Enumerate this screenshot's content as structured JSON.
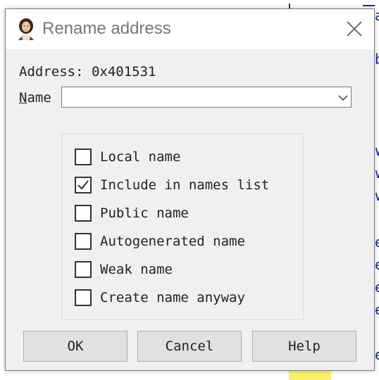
{
  "dialog": {
    "title": "Rename address",
    "address_text": "Address: 0x401531",
    "name_label_mnemonic": "N",
    "name_label_rest": "ame",
    "name_value": ""
  },
  "options": [
    {
      "label": "Local name",
      "checked": false
    },
    {
      "label": "Include in names list",
      "checked": true
    },
    {
      "label": "Public name",
      "checked": false
    },
    {
      "label": "Autogenerated name",
      "checked": false
    },
    {
      "label": "Weak name",
      "checked": false
    },
    {
      "label": "Create name anyway",
      "checked": false
    }
  ],
  "buttons": {
    "ok": "OK",
    "cancel": "Cancel",
    "help": "Help"
  },
  "background_chars": [
    "a",
    "b",
    "w",
    "w",
    "w",
    "e",
    "e",
    "e",
    "e",
    "e"
  ]
}
